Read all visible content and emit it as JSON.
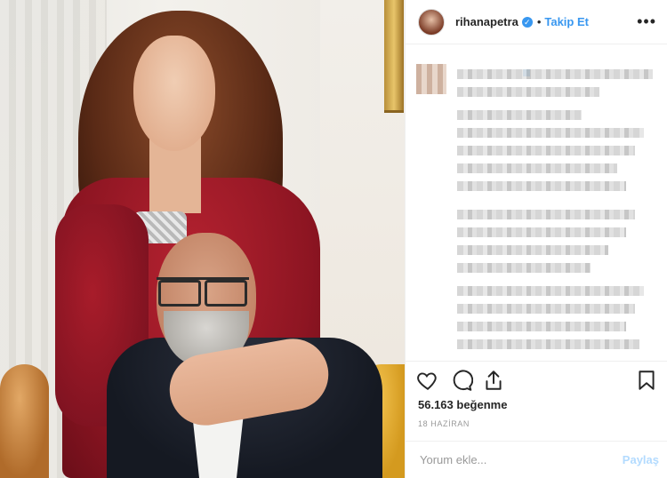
{
  "header": {
    "username": "rihanapetra",
    "verified_symbol": "✓",
    "separator": "•",
    "follow_label": "Takip Et",
    "more_symbol": "•••"
  },
  "photo": {
    "description_icon": "photo"
  },
  "actions": {
    "icons": [
      "heart-icon",
      "comment-icon",
      "share-icon",
      "bookmark-icon"
    ]
  },
  "post": {
    "likes": "56.163 beğenme",
    "date": "18 HAZİRAN"
  },
  "comment_box": {
    "placeholder": "Yorum ekle...",
    "post_label": "Paylaş"
  },
  "colors": {
    "accent": "#3897f0",
    "text": "#262626",
    "muted": "#999999",
    "post_disabled": "#b3dbff"
  }
}
